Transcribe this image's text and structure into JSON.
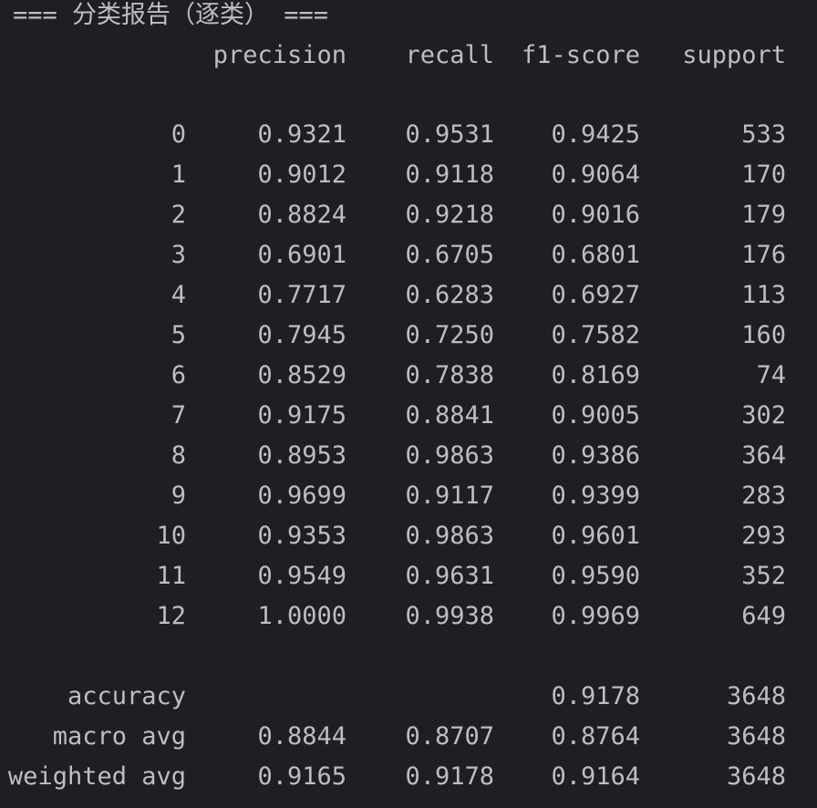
{
  "title": "=== 分类报告（逐类） ===",
  "columns": [
    "precision",
    "recall",
    "f1-score",
    "support"
  ],
  "rows": [
    {
      "label": "0",
      "precision": "0.9321",
      "recall": "0.9531",
      "f1": "0.9425",
      "support": "533"
    },
    {
      "label": "1",
      "precision": "0.9012",
      "recall": "0.9118",
      "f1": "0.9064",
      "support": "170"
    },
    {
      "label": "2",
      "precision": "0.8824",
      "recall": "0.9218",
      "f1": "0.9016",
      "support": "179"
    },
    {
      "label": "3",
      "precision": "0.6901",
      "recall": "0.6705",
      "f1": "0.6801",
      "support": "176"
    },
    {
      "label": "4",
      "precision": "0.7717",
      "recall": "0.6283",
      "f1": "0.6927",
      "support": "113"
    },
    {
      "label": "5",
      "precision": "0.7945",
      "recall": "0.7250",
      "f1": "0.7582",
      "support": "160"
    },
    {
      "label": "6",
      "precision": "0.8529",
      "recall": "0.7838",
      "f1": "0.8169",
      "support": "74"
    },
    {
      "label": "7",
      "precision": "0.9175",
      "recall": "0.8841",
      "f1": "0.9005",
      "support": "302"
    },
    {
      "label": "8",
      "precision": "0.8953",
      "recall": "0.9863",
      "f1": "0.9386",
      "support": "364"
    },
    {
      "label": "9",
      "precision": "0.9699",
      "recall": "0.9117",
      "f1": "0.9399",
      "support": "283"
    },
    {
      "label": "10",
      "precision": "0.9353",
      "recall": "0.9863",
      "f1": "0.9601",
      "support": "293"
    },
    {
      "label": "11",
      "precision": "0.9549",
      "recall": "0.9631",
      "f1": "0.9590",
      "support": "352"
    },
    {
      "label": "12",
      "precision": "1.0000",
      "recall": "0.9938",
      "f1": "0.9969",
      "support": "649"
    }
  ],
  "summary": [
    {
      "label": "accuracy",
      "precision": "",
      "recall": "",
      "f1": "0.9178",
      "support": "3648"
    },
    {
      "label": "macro avg",
      "precision": "0.8844",
      "recall": "0.8707",
      "f1": "0.8764",
      "support": "3648"
    },
    {
      "label": "weighted avg",
      "precision": "0.9165",
      "recall": "0.9178",
      "f1": "0.9164",
      "support": "3648"
    }
  ],
  "colors": {
    "background": "#1e1f22",
    "text": "#bcbec4"
  }
}
